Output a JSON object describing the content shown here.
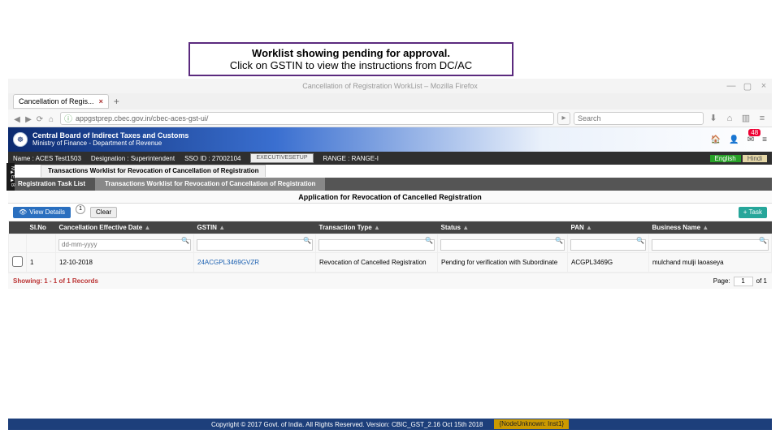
{
  "callout": {
    "line1": "Worklist showing pending for approval.",
    "line2": "Click on GSTIN to view the instructions from DC/AC"
  },
  "window": {
    "title": "Cancellation of Registration WorkList – Mozilla Firefox",
    "tab_title": "Cancellation of Regis...",
    "close": "×",
    "minimize": "—",
    "maximize": "▢"
  },
  "url": "appgstprep.cbec.gov.in/cbec-aces-gst-ui/",
  "search_placeholder": "Search",
  "org": {
    "name": "Central Board of Indirect Taxes and Customs",
    "sub": "Ministry of Finance - Department of Revenue"
  },
  "icons": {
    "home": "🏠",
    "user": "👤",
    "badge_count": "48",
    "menu": "≡"
  },
  "infobar": {
    "name": "Name : ACES Test1503",
    "desig": "Designation : Superintendent",
    "sso": "SSO ID : 27002104",
    "btn": "EXECUTIVESETUP",
    "range": "RANGE : RANGE-I",
    "en": "English",
    "hi": "Hindi"
  },
  "tab2": "Transactions Worklist for Revocation of Cancellation of Registration",
  "tabs3": {
    "a": "Registration Task List",
    "b": "Transactions Worklist for Revocation of Cancellation of Registration"
  },
  "section_head": "Application for Revocation of Cancelled Registration",
  "actions": {
    "view": "View Details",
    "msg": "1",
    "clear": "Clear",
    "task": "+ Task"
  },
  "columns": {
    "chk": "",
    "slno": "Sl.No",
    "cedate": "Cancellation Effective Date",
    "gstin": "GSTIN",
    "ttype": "Transaction Type",
    "status": "Status",
    "pan": "PAN",
    "bname": "Business Name"
  },
  "filters": {
    "date_ph": "dd-mm-yyyy"
  },
  "row": {
    "slno": "1",
    "cedate": "12-10-2018",
    "gstin": "24ACGPL3469GVZR",
    "ttype": "Revocation of Cancelled Registration",
    "status": "Pending for verification with Subordinate",
    "pan": "ACGPL3469G",
    "bname": "mulchand mulji laoaseya"
  },
  "status_left": "Showing: 1 - 1 of 1 Records",
  "page_label": "Page:",
  "page_val": "1",
  "page_of": "of 1",
  "footer": {
    "copy": "Copyright © 2017 Govt. of India. All Rights Reserved. Version: CBIC_GST_2.16 Oct 15th 2018",
    "node": "{NodeUnknown: Inst1}"
  }
}
